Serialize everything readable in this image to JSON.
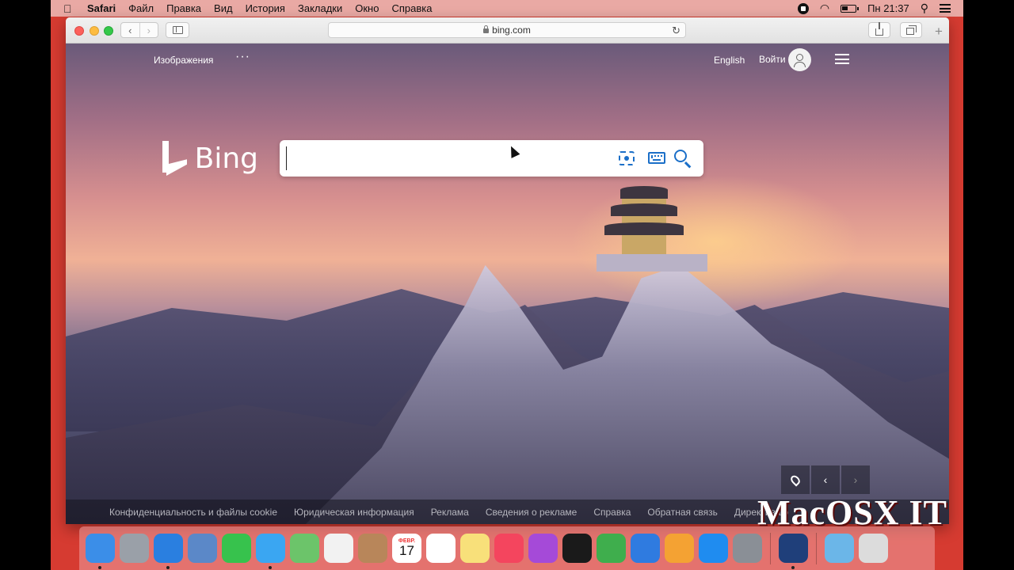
{
  "menubar": {
    "apple": "",
    "items": [
      "Safari",
      "Файл",
      "Правка",
      "Вид",
      "История",
      "Закладки",
      "Окно",
      "Справка"
    ],
    "clock": "Пн 21:37"
  },
  "browser": {
    "address": "bing.com",
    "back_glyph": "‹",
    "forward_glyph": "›",
    "reload_glyph": "↻",
    "new_tab_glyph": "+"
  },
  "bing": {
    "nav_images": "Изображения",
    "nav_more": "···",
    "language": "English",
    "signin": "Войти",
    "logo_word": "Bing",
    "search_value": "",
    "prev_glyph": "‹",
    "next_glyph": "›",
    "footer_links": [
      "Конфиденциальность и файлы cookie",
      "Юридическая информация",
      "Реклама",
      "Сведения о рекламе",
      "Справка",
      "Обратная связь",
      "Директива о"
    ]
  },
  "watermark": "MacOSX IT",
  "dock": {
    "calendar_month": "ФЕВР.",
    "calendar_day": "17",
    "apps": [
      {
        "name": "finder",
        "color": "#3b8ee8"
      },
      {
        "name": "launchpad",
        "color": "#9aa0a8"
      },
      {
        "name": "safari",
        "color": "#2a7fe0"
      },
      {
        "name": "mail",
        "color": "#5b88c8"
      },
      {
        "name": "facetime",
        "color": "#37c24d"
      },
      {
        "name": "messages",
        "color": "#3aa6f2"
      },
      {
        "name": "maps",
        "color": "#6cc46a"
      },
      {
        "name": "photos",
        "color": "#f2f2f2"
      },
      {
        "name": "contacts",
        "color": "#b8865a"
      },
      {
        "name": "calendar",
        "color": "#ffffff"
      },
      {
        "name": "reminders",
        "color": "#ffffff"
      },
      {
        "name": "notes",
        "color": "#f8e07a"
      },
      {
        "name": "music",
        "color": "#f4455e"
      },
      {
        "name": "podcasts",
        "color": "#a54ad8"
      },
      {
        "name": "apple-tv",
        "color": "#1a1a1a"
      },
      {
        "name": "numbers",
        "color": "#3fae4d"
      },
      {
        "name": "keynote",
        "color": "#2f7be0"
      },
      {
        "name": "pages",
        "color": "#f4a233"
      },
      {
        "name": "app-store",
        "color": "#1f8cf0"
      },
      {
        "name": "system-preferences",
        "color": "#8a8f96"
      },
      {
        "name": "quicktime",
        "color": "#1f3f7a"
      },
      {
        "name": "downloads",
        "color": "#6bb6e8"
      },
      {
        "name": "trash",
        "color": "#dcdcdc"
      }
    ]
  }
}
